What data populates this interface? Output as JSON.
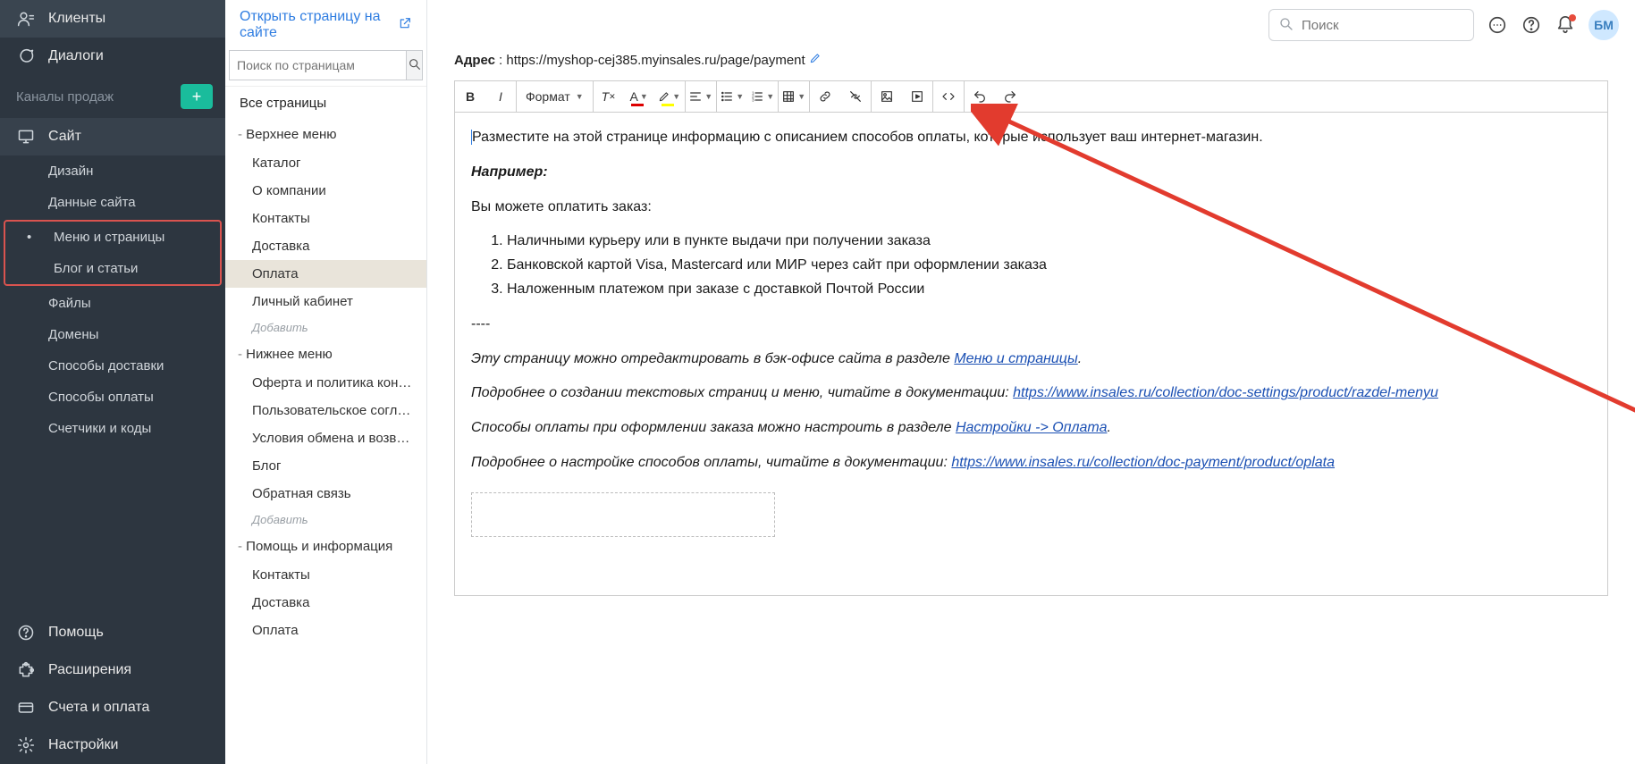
{
  "sidebar": {
    "clients": "Клиенты",
    "dialogs": "Диалоги",
    "channels_header": "Каналы продаж",
    "site": "Сайт",
    "site_children": {
      "design": "Дизайн",
      "site_data": "Данные сайта",
      "menu_pages": "Меню и страницы",
      "blog": "Блог и статьи",
      "files": "Файлы",
      "domains": "Домены",
      "delivery_methods": "Способы доставки",
      "payment_methods": "Способы оплаты",
      "counters": "Счетчики и коды"
    },
    "help": "Помощь",
    "extensions": "Расширения",
    "billing": "Счета и оплата",
    "settings": "Настройки"
  },
  "pages_panel": {
    "open_link": "Открыть страницу на сайте",
    "search_placeholder": "Поиск по страницам",
    "all_pages": "Все страницы",
    "top_menu": "Верхнее меню",
    "top_items": {
      "catalog": "Каталог",
      "about": "О компании",
      "contacts": "Контакты",
      "delivery": "Доставка",
      "payment": "Оплата",
      "cabinet": "Личный кабинет"
    },
    "add": "Добавить",
    "bottom_menu": "Нижнее меню",
    "bottom_items": {
      "offer": "Оферта и политика конфиденциальности",
      "agreement": "Пользовательское соглашение",
      "returns": "Условия обмена и возврата",
      "blog": "Блог",
      "feedback": "Обратная связь"
    },
    "help_menu": "Помощь и информация",
    "help_items": {
      "contacts": "Контакты",
      "delivery": "Доставка",
      "payment": "Оплата"
    }
  },
  "topbar": {
    "search_placeholder": "Поиск",
    "avatar": "БМ"
  },
  "page": {
    "address_label": "Адрес",
    "address_url": ": https://myshop-cej385.myinsales.ru/page/payment"
  },
  "toolbar": {
    "format": "Формат"
  },
  "editor": {
    "intro": "Разместите на этой странице информацию с описанием способов оплаты, которые использует ваш интернет-магазин.",
    "example_heading": "Например:",
    "can_pay": "Вы можете оплатить заказ:",
    "li1": "Наличными курьеру или в пункте выдачи при получении заказа",
    "li2": "Банковской картой Visa, Mastercard или МИР через сайт при оформлении заказа",
    "li3": "Наложенным платежом при заказе с доставкой Почтой России",
    "dashes": "----",
    "edit_hint_pre": "Эту страницу можно отредактировать в бэк-офисе сайта в разделе ",
    "edit_hint_link": "Меню и страницы",
    "edit_hint_post": ".",
    "doc1_pre": "Подробнее о создании текстовых страниц и меню, читайте в документации: ",
    "doc1_link": "https://www.insales.ru/collection/doc-settings/product/razdel-menyu",
    "payment_settings_pre": "Способы оплаты при оформлении заказа можно настроить в разделе ",
    "payment_settings_link": "Настройки -> Оплата",
    "payment_settings_post": ".",
    "doc2_pre": "Подробнее о настройке способов оплаты, читайте в документации: ",
    "doc2_link": "https://www.insales.ru/collection/doc-payment/product/oplata"
  }
}
